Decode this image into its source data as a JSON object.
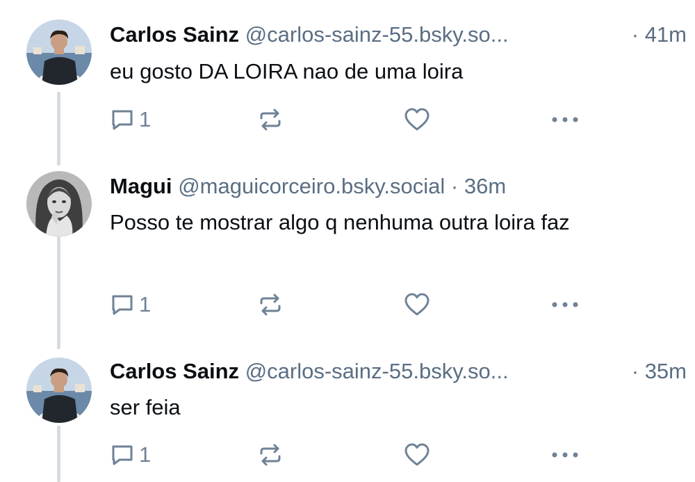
{
  "posts": [
    {
      "author_name": "Carlos Sainz",
      "handle": "@carlos-sainz-55.bsky.so...",
      "separator": "·",
      "time": "41m",
      "text": "eu gosto DA LOIRA nao de uma loira",
      "reply_count": "1",
      "avatar": "profile-photo-man-on-boat"
    },
    {
      "author_name": "Magui",
      "handle": "@maguicorceiro.bsky.social",
      "separator": "·",
      "time": "36m",
      "text": "Posso te mostrar algo q nenhuma outra loira faz",
      "reply_count": "1",
      "avatar": "profile-photo-woman-black-and-white"
    },
    {
      "author_name": "Carlos Sainz",
      "handle": "@carlos-sainz-55.bsky.so...",
      "separator": "·",
      "time": "35m",
      "text": "ser feia",
      "reply_count": "1",
      "avatar": "profile-photo-man-on-boat"
    }
  ],
  "icons": {
    "reply": "reply-icon",
    "repost": "repost-icon",
    "like": "heart-icon",
    "more": "more-options-icon"
  },
  "colors": {
    "text": "#0b0f14",
    "muted": "#5a6e83",
    "icon": "#6f8296",
    "thread_line": "#d4dbe2"
  }
}
